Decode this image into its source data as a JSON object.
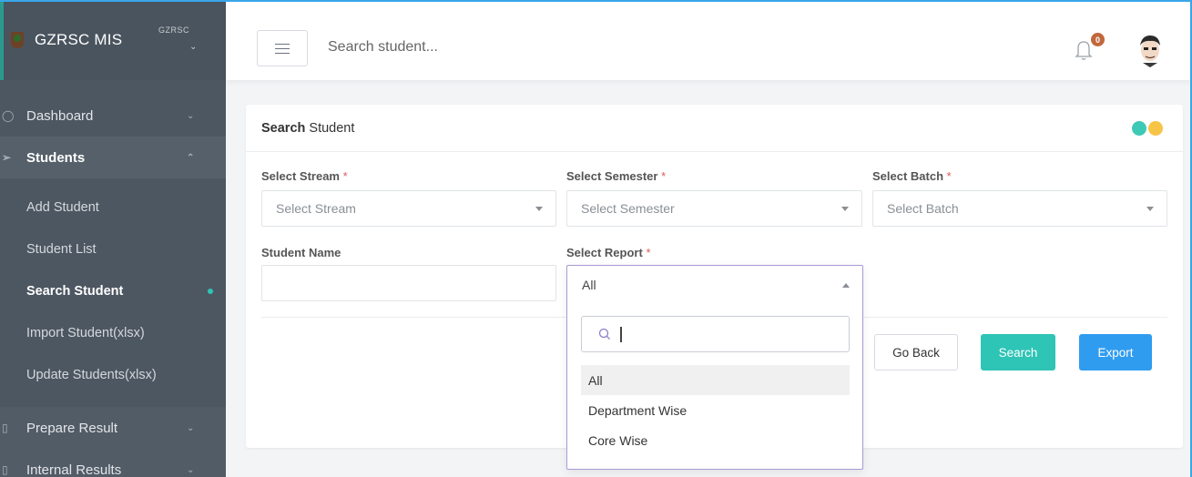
{
  "sidebar": {
    "brand": "GZRSC MIS",
    "brand_sub": "GZRSC",
    "items": [
      {
        "label": "Dashboard"
      },
      {
        "label": "Students"
      },
      {
        "label": "Prepare Result"
      },
      {
        "label": "Internal Results"
      }
    ],
    "sub_items": [
      {
        "label": "Add Student"
      },
      {
        "label": "Student List"
      },
      {
        "label": "Search Student"
      },
      {
        "label": "Import Student(xlsx)"
      },
      {
        "label": "Update Students(xlsx)"
      }
    ]
  },
  "header": {
    "search_placeholder": "Search student...",
    "notification_count": "0"
  },
  "card": {
    "title_bold": "Search",
    "title_rest": " Student",
    "dot_colors": [
      "#3ec9b6",
      "#f6c548"
    ]
  },
  "form": {
    "stream": {
      "label": "Select Stream",
      "placeholder": "Select Stream"
    },
    "semester": {
      "label": "Select Semester",
      "placeholder": "Select Semester"
    },
    "batch": {
      "label": "Select Batch",
      "placeholder": "Select Batch"
    },
    "student_name": {
      "label": "Student Name",
      "value": ""
    },
    "report": {
      "label": "Select Report",
      "value": "All"
    },
    "required_mark": "*"
  },
  "buttons": {
    "go_back": "Go Back",
    "search": "Search",
    "export": "Export",
    "colors": {
      "search": "#2ec4b6",
      "export": "#2f9cf0"
    }
  },
  "report_dropdown": {
    "search_value": "",
    "options": [
      "All",
      "Department Wise",
      "Core Wise"
    ],
    "selected": "All"
  }
}
